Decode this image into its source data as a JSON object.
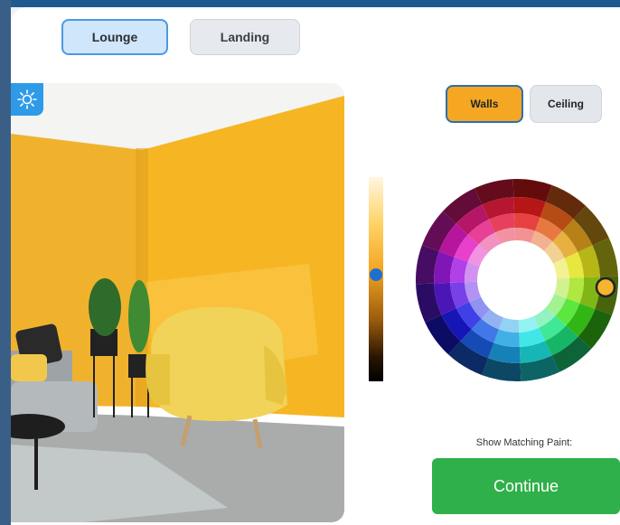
{
  "rooms": {
    "tabs": [
      {
        "label": "Lounge",
        "active": true
      },
      {
        "label": "Landing",
        "active": false
      }
    ]
  },
  "surfaces": {
    "tabs": [
      {
        "label": "Walls",
        "active": true
      },
      {
        "label": "Ceiling",
        "active": false
      }
    ]
  },
  "colors": {
    "selected_wall": "#f5b52e",
    "accent": "#f5a623",
    "continue": "#2fb04a",
    "top_bar": "#1f5a8e"
  },
  "shade_slider": {
    "value": 0.48
  },
  "matching_paint": {
    "label": "Show Matching Paint:",
    "continue_label": "Continue"
  },
  "icons": {
    "lighting": "sun-icon"
  }
}
